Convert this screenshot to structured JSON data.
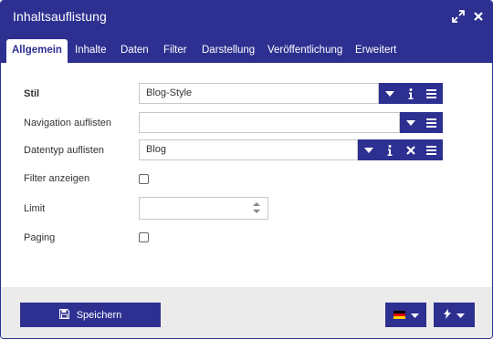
{
  "window": {
    "title": "Inhaltsauflistung"
  },
  "tabs": [
    {
      "label": "Allgemein",
      "active": true
    },
    {
      "label": "Inhalte"
    },
    {
      "label": "Daten"
    },
    {
      "label": "Filter"
    },
    {
      "label": "Darstellung"
    },
    {
      "label": "Veröffentlichung"
    },
    {
      "label": "Erweitert"
    }
  ],
  "form": {
    "stil": {
      "label": "Stil",
      "value": "Blog-Style"
    },
    "navigation": {
      "label": "Navigation auflisten",
      "value": ""
    },
    "datentyp": {
      "label": "Datentyp auflisten",
      "value": "Blog"
    },
    "filter": {
      "label": "Filter anzeigen",
      "checked": false
    },
    "limit": {
      "label": "Limit",
      "value": ""
    },
    "paging": {
      "label": "Paging",
      "checked": false
    }
  },
  "footer": {
    "save_label": "Speichern"
  },
  "colors": {
    "primary": "#2d3091",
    "footer_bg": "#ebebeb"
  },
  "icons": [
    "expand-icon",
    "close-icon",
    "dropdown-icon",
    "info-icon",
    "menu-icon",
    "remove-icon",
    "save-icon",
    "flag-de-icon",
    "bolt-icon",
    "spinner-icon"
  ]
}
